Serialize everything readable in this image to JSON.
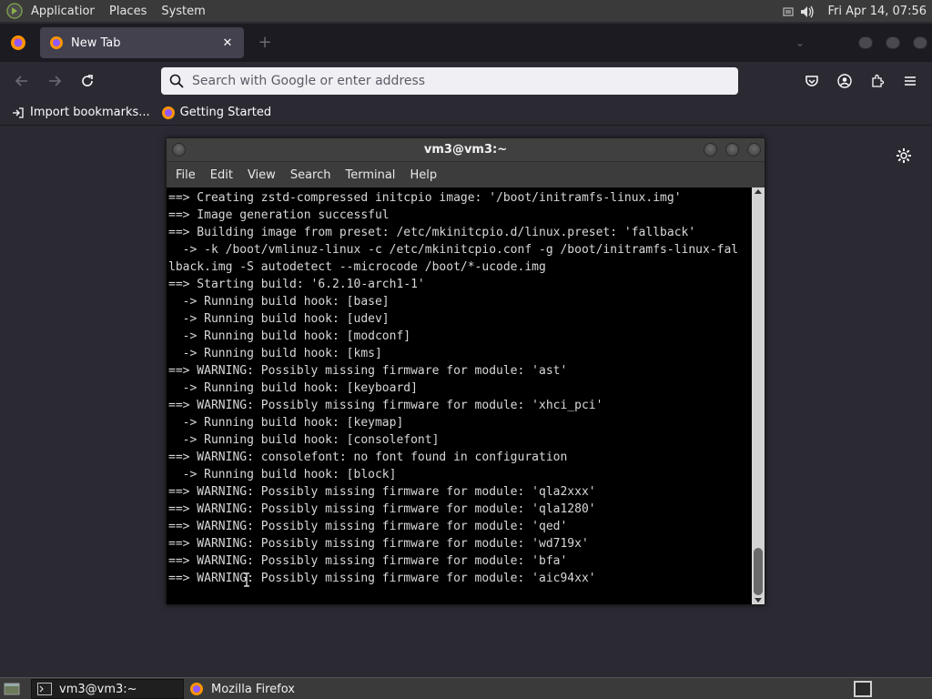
{
  "top_panel": {
    "menus": [
      "Applications",
      "Places",
      "System"
    ],
    "clock": "Fri Apr 14, 07:56"
  },
  "browser": {
    "tab_title": "New Tab",
    "tab_close": "✕",
    "new_tab": "+",
    "address_placeholder": "Search with Google or enter address",
    "bookmarks": [
      "Import bookmarks...",
      "Getting Started"
    ]
  },
  "terminal": {
    "title": "vm3@vm3:~",
    "menu": [
      "File",
      "Edit",
      "View",
      "Search",
      "Terminal",
      "Help"
    ],
    "lines": [
      "==> Creating zstd-compressed initcpio image: '/boot/initramfs-linux.img'",
      "==> Image generation successful",
      "==> Building image from preset: /etc/mkinitcpio.d/linux.preset: 'fallback'",
      "  -> -k /boot/vmlinuz-linux -c /etc/mkinitcpio.conf -g /boot/initramfs-linux-fal",
      "lback.img -S autodetect --microcode /boot/*-ucode.img",
      "==> Starting build: '6.2.10-arch1-1'",
      "  -> Running build hook: [base]",
      "  -> Running build hook: [udev]",
      "  -> Running build hook: [modconf]",
      "  -> Running build hook: [kms]",
      "==> WARNING: Possibly missing firmware for module: 'ast'",
      "  -> Running build hook: [keyboard]",
      "==> WARNING: Possibly missing firmware for module: 'xhci_pci'",
      "  -> Running build hook: [keymap]",
      "  -> Running build hook: [consolefont]",
      "==> WARNING: consolefont: no font found in configuration",
      "  -> Running build hook: [block]",
      "==> WARNING: Possibly missing firmware for module: 'qla2xxx'",
      "==> WARNING: Possibly missing firmware for module: 'qla1280'",
      "==> WARNING: Possibly missing firmware for module: 'qed'",
      "==> WARNING: Possibly missing firmware for module: 'wd719x'",
      "==> WARNING: Possibly missing firmware for module: 'bfa'",
      "==> WARNING: Possibly missing firmware for module: 'aic94xx'"
    ]
  },
  "taskbar": {
    "items": [
      "vm3@vm3:~",
      "Mozilla Firefox"
    ]
  },
  "colors": {
    "firefox_orange": "#ff9500",
    "firefox_purple": "#9059ff"
  }
}
